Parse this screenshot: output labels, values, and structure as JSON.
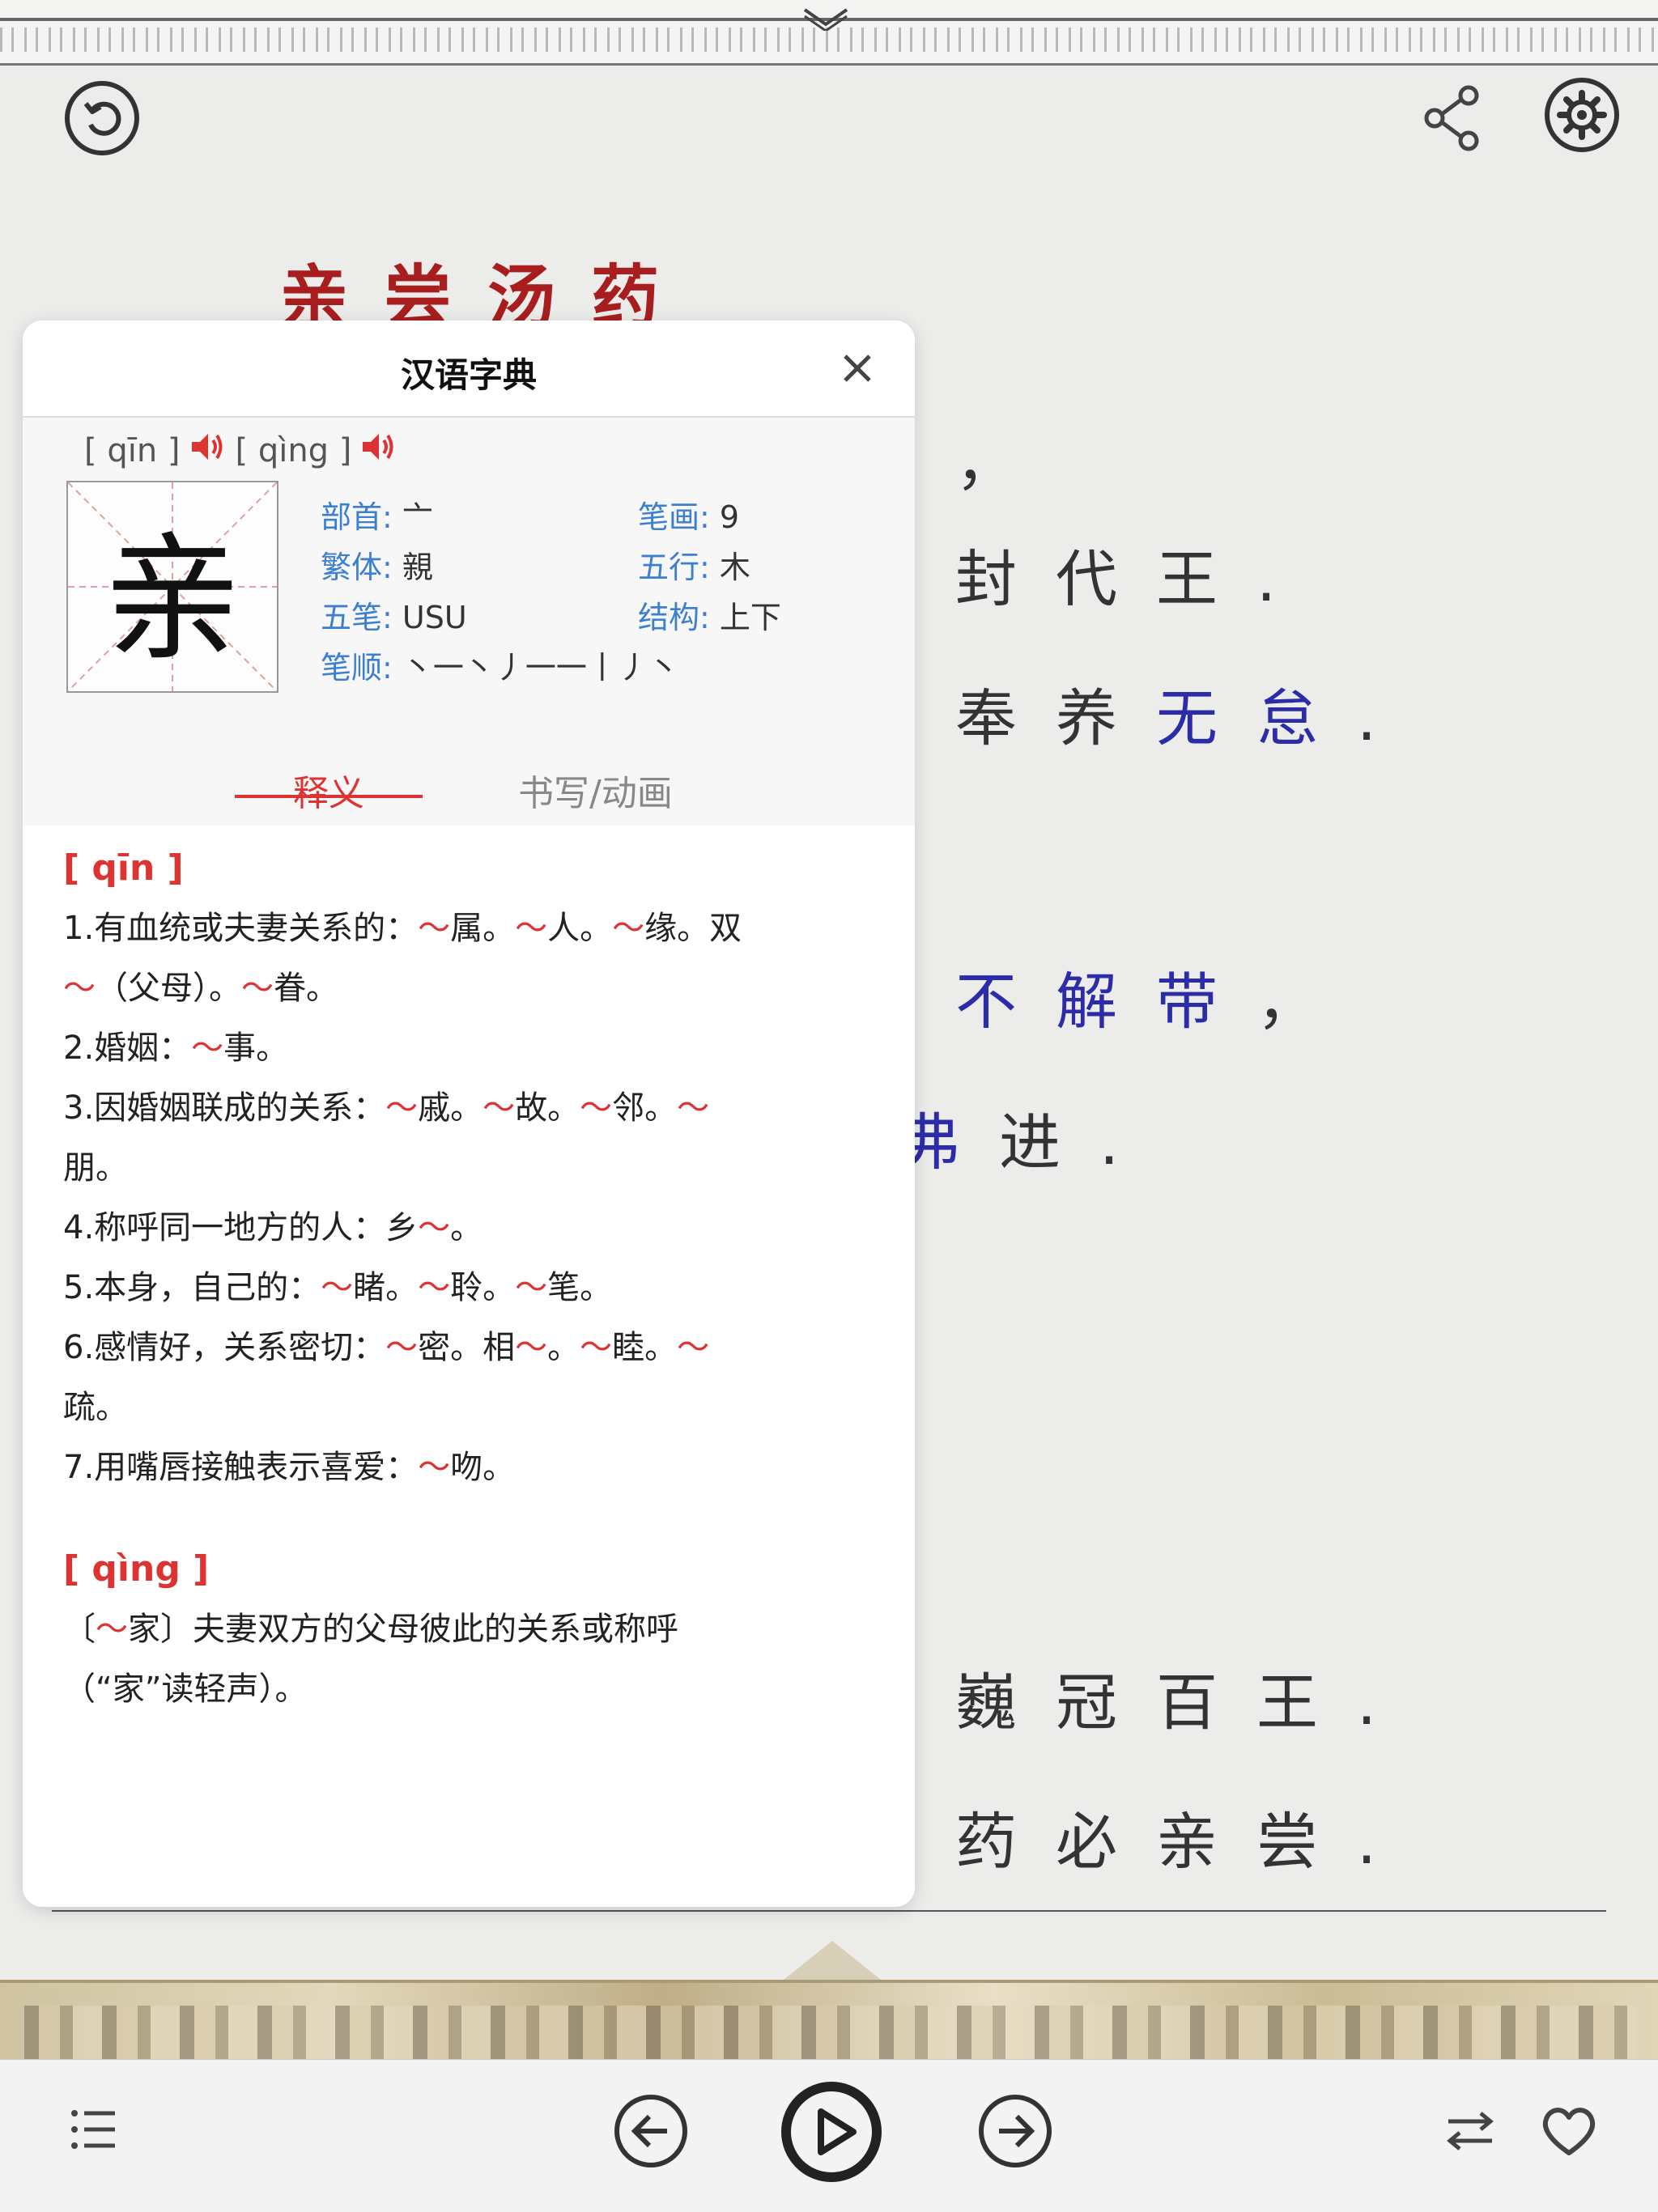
{
  "poem": {
    "title": "亲尝汤药",
    "comma_line": "，",
    "lines": [
      {
        "text": "封代王.",
        "highlight": ""
      },
      {
        "text": "奉养",
        "highlight": "无怠",
        "end": "."
      },
      {
        "text": "",
        "highlight": "不解带",
        "end": "，"
      },
      {
        "text": "",
        "partial_hl": "弗",
        "end_text": "进."
      },
      {
        "text": "巍冠百王."
      },
      {
        "text": "药必亲尝."
      }
    ]
  },
  "topbar": {
    "back_icon": "back-arrow-icon",
    "share_icon": "share-icon",
    "settings_icon": "gear-icon"
  },
  "dictionary": {
    "title": "汉语字典",
    "pronunciations": [
      {
        "label": "[ qīn ]"
      },
      {
        "label": "[ qìng ]"
      }
    ],
    "character": "亲",
    "fields": {
      "radical_label": "部首:",
      "radical": "亠",
      "strokes_label": "笔画:",
      "strokes": "9",
      "traditional_label": "繁体:",
      "traditional": "親",
      "wuxing_label": "五行:",
      "wuxing": "木",
      "wubi_label": "五笔:",
      "wubi": "USU",
      "structure_label": "结构:",
      "structure": "上下",
      "order_label": "笔顺:",
      "order": "丶一丶丿一一丨丿丶"
    },
    "tabs": {
      "meaning": "释义",
      "writing": "书写/动画"
    },
    "sections": [
      {
        "head": "[ qīn ]",
        "defs": [
          [
            "1.有血统或夫妻关系的：",
            "～",
            "属。",
            "～",
            "人。",
            "～",
            "缘。双"
          ],
          [
            "～",
            "（父母）。",
            "～",
            "眷。"
          ],
          [
            "2.婚姻：",
            "～",
            "事。"
          ],
          [
            "3.因婚姻联成的关系：",
            "～",
            "戚。",
            "～",
            "故。",
            "～",
            "邻。",
            "～"
          ],
          [
            "朋。"
          ],
          [
            "4.称呼同一地方的人：乡",
            "～",
            "。"
          ],
          [
            "5.本身，自己的：",
            "～",
            "睹。",
            "～",
            "聆。",
            "～",
            "笔。"
          ],
          [
            "6.感情好，关系密切：",
            "～",
            "密。相",
            "～",
            "。",
            "～",
            "睦。",
            "～"
          ],
          [
            "疏。"
          ],
          [
            "7.用嘴唇接触表示喜爱：",
            "～",
            "吻。"
          ]
        ]
      },
      {
        "head": "[ qìng ]",
        "defs": [
          [
            "〔",
            "～",
            "家〕夫妻双方的父母彼此的关系或称呼"
          ],
          [
            "（“家”读轻声）。"
          ]
        ]
      }
    ]
  },
  "colors": {
    "accent_red": "#d33333",
    "blue": "#3c7fd0",
    "title_red": "#a81e1e"
  }
}
